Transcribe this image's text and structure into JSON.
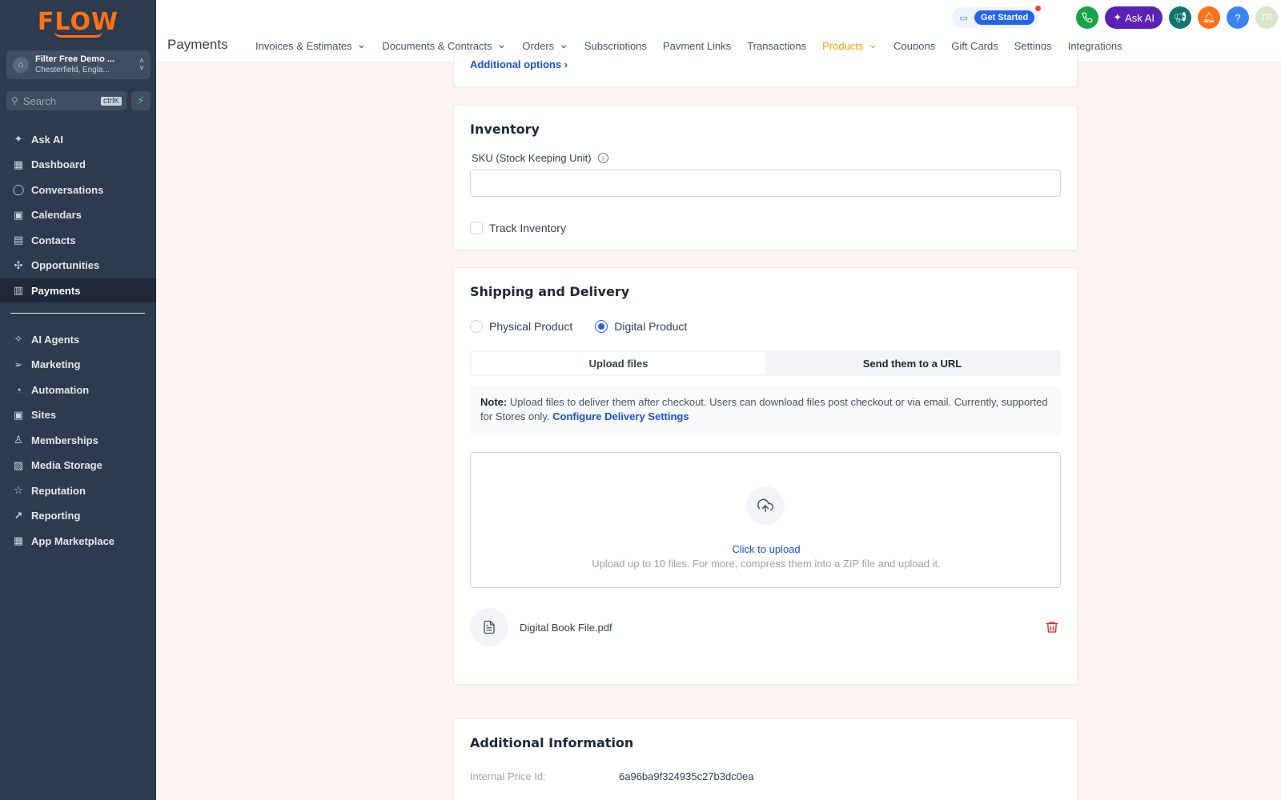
{
  "sidebar": {
    "logo": "FLOW",
    "account": {
      "name": "Filter Free Demo ...",
      "location": "Chesterfield, Engla..."
    },
    "search": {
      "placeholder": "Search",
      "shortcut": "ctrlK"
    },
    "items_top": [
      {
        "label": "Ask AI",
        "icon": "sparkle-icon",
        "glyph": "✦"
      },
      {
        "label": "Dashboard",
        "icon": "dashboard-icon",
        "glyph": "▦"
      },
      {
        "label": "Conversations",
        "icon": "chat-icon",
        "glyph": "◯"
      },
      {
        "label": "Calendars",
        "icon": "calendar-icon",
        "glyph": "▣"
      },
      {
        "label": "Contacts",
        "icon": "contacts-icon",
        "glyph": "▤"
      },
      {
        "label": "Opportunities",
        "icon": "opportunities-icon",
        "glyph": "✣"
      },
      {
        "label": "Payments",
        "icon": "payments-icon",
        "glyph": "▥"
      }
    ],
    "items_bottom": [
      {
        "label": "AI Agents",
        "icon": "ai-agents-icon",
        "glyph": "✧"
      },
      {
        "label": "Marketing",
        "icon": "send-icon",
        "glyph": "➢"
      },
      {
        "label": "Automation",
        "icon": "automation-icon",
        "glyph": "◔"
      },
      {
        "label": "Sites",
        "icon": "sites-icon",
        "glyph": "▣"
      },
      {
        "label": "Memberships",
        "icon": "membership-icon",
        "glyph": "♙"
      },
      {
        "label": "Media Storage",
        "icon": "image-icon",
        "glyph": "▨"
      },
      {
        "label": "Reputation",
        "icon": "star-icon",
        "glyph": "☆"
      },
      {
        "label": "Reporting",
        "icon": "trend-icon",
        "glyph": "↗"
      },
      {
        "label": "App Marketplace",
        "icon": "apps-icon",
        "glyph": "▦"
      }
    ],
    "active": "Payments"
  },
  "header": {
    "page_title": "Payments",
    "tabs": [
      {
        "label": "Invoices & Estimates",
        "dropdown": true
      },
      {
        "label": "Documents & Contracts",
        "dropdown": true
      },
      {
        "label": "Orders",
        "dropdown": true
      },
      {
        "label": "Subscriptions",
        "dropdown": false
      },
      {
        "label": "Payment Links",
        "dropdown": false
      },
      {
        "label": "Transactions",
        "dropdown": false
      },
      {
        "label": "Products",
        "dropdown": true
      },
      {
        "label": "Coupons",
        "dropdown": false
      },
      {
        "label": "Gift Cards",
        "dropdown": false
      },
      {
        "label": "Settings",
        "dropdown": false
      },
      {
        "label": "Integrations",
        "dropdown": false
      }
    ],
    "active_tab": "Products",
    "get_started": "Get Started",
    "ask_ai": "Ask AI",
    "help": "?",
    "avatar": "TR"
  },
  "colors": {
    "sidebar_bg": "#2e3a4d",
    "accent": "#f59e0b",
    "link": "#1d4ed8",
    "phone": "#16a34a",
    "megaphone": "#0f766e",
    "bell": "#f97316",
    "help": "#3b82f6",
    "ask_ai": "#5b21b6",
    "danger": "#dc2626"
  },
  "main": {
    "additional_options": "Additional options ›",
    "inventory": {
      "title": "Inventory",
      "sku_label": "SKU (Stock Keeping Unit)",
      "sku_value": "",
      "track_inventory": "Track Inventory",
      "track_checked": false
    },
    "shipping": {
      "title": "Shipping and Delivery",
      "physical": "Physical Product",
      "digital": "Digital Product",
      "selected": "Digital Product",
      "upload_tab": "Upload files",
      "url_tab": "Send them to a URL",
      "note_prefix": "Note:",
      "note_text": "Upload files to deliver them after checkout. Users can download files post checkout or via email. Currently, supported for Stores only.",
      "note_link": "Configure Delivery Settings",
      "upload_click": "Click to upload",
      "upload_hint": "Upload up to 10 files. For more, compress them into a ZIP file and upload it.",
      "file_name": "Digital Book File.pdf"
    },
    "additional_info": {
      "title": "Additional Information",
      "price_id_label": "Internal Price Id:",
      "price_id_value": "6a96ba9f324935c27b3dc0ea"
    }
  }
}
